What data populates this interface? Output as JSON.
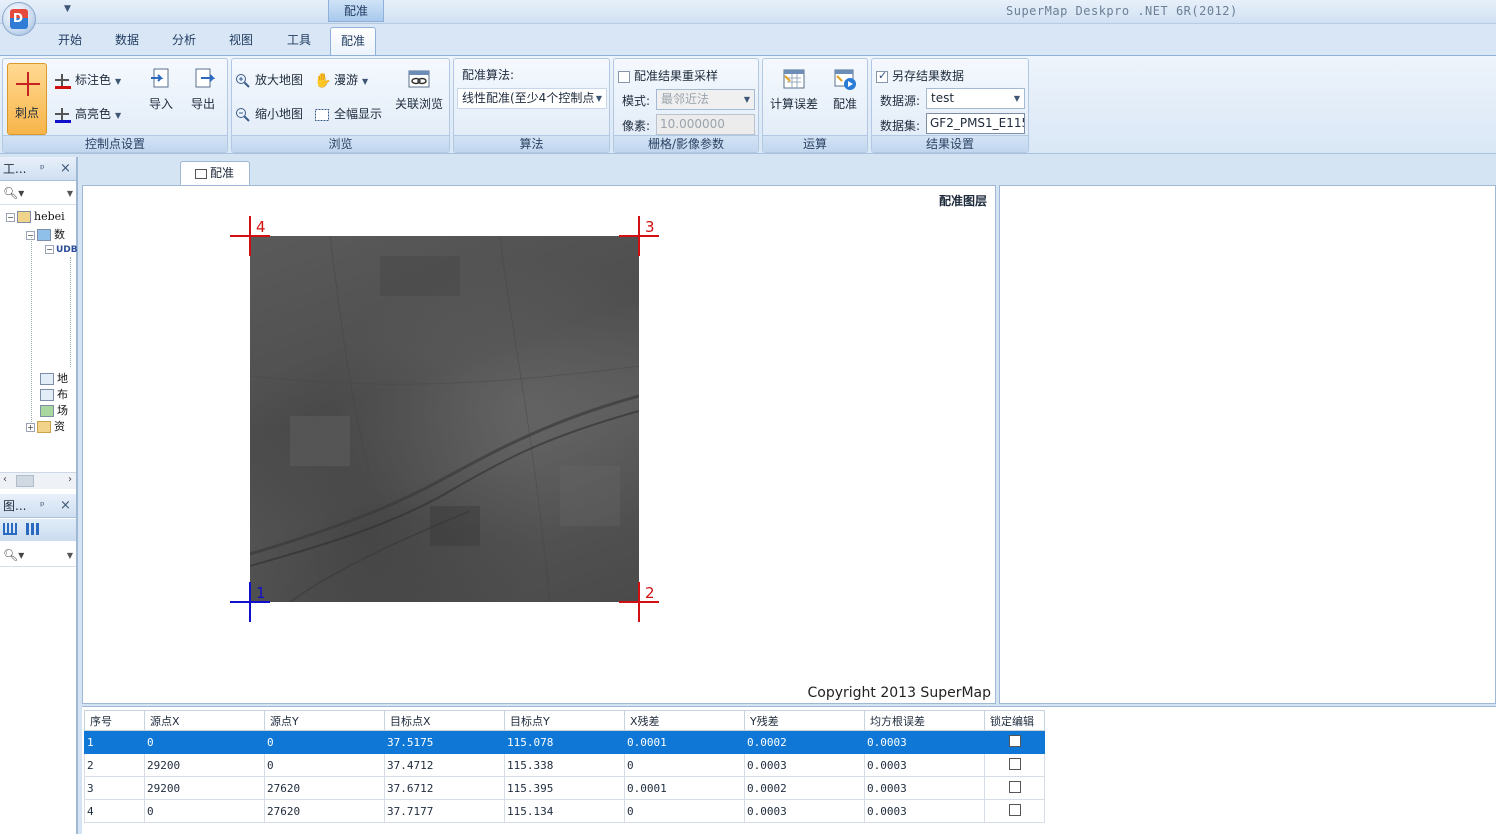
{
  "title_bar": {
    "window_title": "SuperMap Deskpro .NET 6R(2012)",
    "context_tab_header": "配准",
    "app_logo_letter": "D"
  },
  "ribbon_tabs": [
    "开始",
    "数据",
    "分析",
    "视图",
    "工具",
    "配准"
  ],
  "active_tab": "配准",
  "groups": {
    "control_points": {
      "label": "控制点设置",
      "pick_point": "刺点",
      "mark_color": "标注色",
      "highlight_color": "高亮色",
      "import": "导入",
      "export": "导出"
    },
    "browse": {
      "label": "浏览",
      "zoom_in": "放大地图",
      "zoom_out": "缩小地图",
      "pan": "漫游",
      "full_extent": "全幅显示",
      "linked_browse": "关联浏览"
    },
    "algorithm": {
      "label": "算法",
      "caption": "配准算法:",
      "value": "线性配准(至少4个控制点"
    },
    "raster_params": {
      "label": "栅格/影像参数",
      "resample_checkbox": "配准结果重采样",
      "resample_checked": false,
      "mode_label": "模式:",
      "mode_value": "最邻近法",
      "pixel_label": "像素:",
      "pixel_value": "10.000000"
    },
    "compute": {
      "label": "运算",
      "calc_error": "计算误差",
      "register": "配准"
    },
    "result": {
      "label": "结果设置",
      "save_checkbox": "另存结果数据",
      "save_checked": true,
      "datasource_label": "数据源:",
      "datasource_value": "test",
      "dataset_label": "数据集:",
      "dataset_value": "GF2_PMS1_E115_"
    }
  },
  "workspace_panel": {
    "title": "工...",
    "pin": "ᵖ",
    "close": "×",
    "tree": {
      "root": "hebei",
      "datasources": "数",
      "udb": "UDB",
      "maps": "地",
      "layouts": "布",
      "scenes": "场",
      "resources": "资"
    }
  },
  "layer_panel": {
    "title": "图...",
    "pin": "ᵖ",
    "close": "×"
  },
  "doc_tab": "配准",
  "map": {
    "layer_label": "配准图层",
    "copyright": "Copyright 2013 SuperMap",
    "control_points": [
      {
        "id": "1",
        "color": "#1010c8"
      },
      {
        "id": "2",
        "color": "#d01010"
      },
      {
        "id": "3",
        "color": "#d01010"
      },
      {
        "id": "4",
        "color": "#d01010"
      }
    ]
  },
  "table": {
    "headers": [
      "序号",
      "源点X",
      "源点Y",
      "目标点X",
      "目标点Y",
      "X残差",
      "Y残差",
      "均方根误差",
      "锁定编辑"
    ],
    "rows": [
      [
        "1",
        "0",
        "0",
        "37.5175",
        "115.078",
        "0.0001",
        "0.0002",
        "0.0003"
      ],
      [
        "2",
        "29200",
        "0",
        "37.4712",
        "115.338",
        "0",
        "0.0003",
        "0.0003"
      ],
      [
        "3",
        "29200",
        "27620",
        "37.6712",
        "115.395",
        "0.0001",
        "0.0002",
        "0.0003"
      ],
      [
        "4",
        "0",
        "27620",
        "37.7177",
        "115.134",
        "0",
        "0.0003",
        "0.0003"
      ]
    ],
    "selected_row": 0
  },
  "colors": {
    "selection": "#0f78d7",
    "mark_color": "#d01010",
    "highlight_color": "#1010c8",
    "pick_button": "#f7b54a"
  }
}
